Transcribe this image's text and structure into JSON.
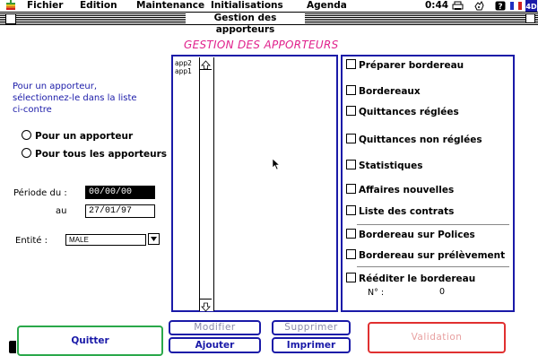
{
  "menubar": {
    "apple_icon": "apple-logo",
    "menus": [
      "Fichier",
      "Edition",
      "Maintenance",
      "Initialisations",
      "Agenda"
    ],
    "clock": "0:44"
  },
  "window": {
    "title": "Gestion des apporteurs"
  },
  "heading": "GESTION DES APPORTEURS",
  "instructions": [
    "Pour un apporteur,",
    "sélectionnez-le dans la liste",
    "ci-contre"
  ],
  "radios": [
    "Pour un apporteur",
    "Pour tous les apporteurs"
  ],
  "period": {
    "label_from": "Période du :",
    "from_value": "00/00/00",
    "label_to": "au",
    "to_value": "27/01/97"
  },
  "entity": {
    "label": "Entité :",
    "value": "MALE"
  },
  "list": {
    "items": [
      "app2",
      "app1"
    ]
  },
  "checkboxes": [
    "Préparer bordereau",
    "Bordereaux",
    "Quittances réglées",
    "Quittances non réglées",
    "Statistiques",
    "Affaires nouvelles",
    "Liste des contrats",
    "Bordereau sur Polices",
    "Bordereau sur prélèvement",
    "Rééditer le bordereau"
  ],
  "reedit": {
    "label": "N° :",
    "value": "0"
  },
  "buttons": {
    "quit": "Quitter",
    "modify": "Modifier",
    "delete": "Supprimer",
    "add": "Ajouter",
    "print": "Imprimer",
    "validate": "Validation"
  },
  "colors": {
    "accent_blue": "#1a1aa8",
    "heading_pink": "#e0208c",
    "validate_red": "#e03030"
  }
}
